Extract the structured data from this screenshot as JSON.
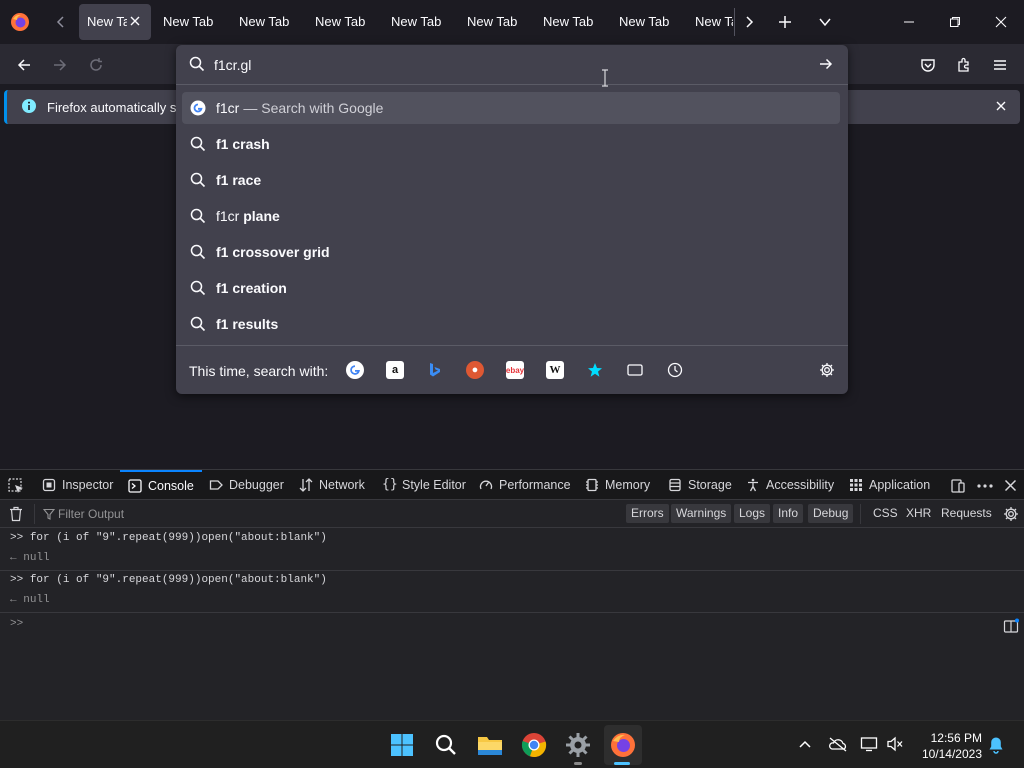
{
  "tabs": {
    "active_label": "New Tab",
    "labels": [
      "New Tab",
      "New Tab",
      "New Tab",
      "New Tab",
      "New Tab",
      "New Tab",
      "New Tab",
      "New Tab",
      "New Tab"
    ]
  },
  "urlbar": {
    "value": "f1cr.gl",
    "heuristic": {
      "query": "f1cr",
      "action": "— Search with Google"
    },
    "suggestions": [
      {
        "prefix": "f1 ",
        "bold": "crash"
      },
      {
        "prefix": "f1 ",
        "bold": "race"
      },
      {
        "prefix": "f1cr ",
        "bold": "plane"
      },
      {
        "prefix": "f1 ",
        "bold": "crossover grid"
      },
      {
        "prefix": "f1 ",
        "bold": "creation"
      },
      {
        "prefix": "f1 ",
        "bold": "results"
      }
    ],
    "oneoff_label": "This time, search with:",
    "engine_icons": [
      "google-icon",
      "amazon-icon",
      "bing-icon",
      "duckduckgo-icon",
      "ebay-icon",
      "wikipedia-icon",
      "bookmarks-icon",
      "tabs-icon",
      "history-icon"
    ]
  },
  "infobar": {
    "text": "Firefox automatically sen"
  },
  "devtools": {
    "tabs": [
      "Inspector",
      "Console",
      "Debugger",
      "Network",
      "Style Editor",
      "Performance",
      "Memory",
      "Storage",
      "Accessibility",
      "Application"
    ],
    "active_tab": "Console",
    "filter_placeholder": "Filter Output",
    "levels": [
      "Errors",
      "Warnings",
      "Logs",
      "Info",
      "Debug"
    ],
    "types": [
      "CSS",
      "XHR",
      "Requests"
    ],
    "log": [
      {
        "input": "for (i of \"9\".repeat(999))open(\"about:blank\")",
        "output": "null"
      },
      {
        "input": "for (i of \"9\".repeat(999))open(\"about:blank\")",
        "output": "null"
      }
    ]
  },
  "taskbar": {
    "time": "12:56 PM",
    "date": "10/14/2023"
  },
  "colors": {
    "accent": "#0a84ff",
    "panel": "#42414d",
    "background": "#1c1b22"
  }
}
